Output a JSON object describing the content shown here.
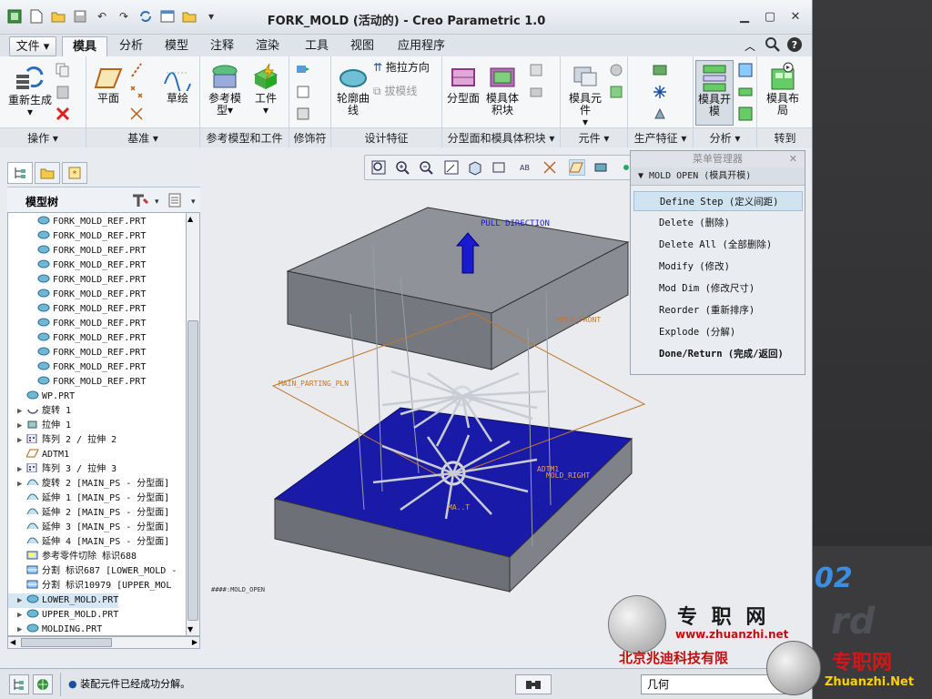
{
  "window": {
    "title": "FORK_MOLD (活动的) - Creo Parametric 1.0",
    "controls": [
      "minimize",
      "maximize",
      "close"
    ]
  },
  "tabs": [
    {
      "label": "文件 ▾",
      "active": false,
      "file": true
    },
    {
      "label": "模具",
      "active": true
    },
    {
      "label": "分析"
    },
    {
      "label": "模型"
    },
    {
      "label": "注释"
    },
    {
      "label": "渲染"
    },
    {
      "label": "工具"
    },
    {
      "label": "视图"
    },
    {
      "label": "应用程序"
    }
  ],
  "ribbon": {
    "groups": [
      {
        "label": "操作 ▾"
      },
      {
        "label": "基准 ▾"
      },
      {
        "label": "参考模型和工件"
      },
      {
        "label": "修饰符"
      },
      {
        "label": "设计特征"
      },
      {
        "label": "分型面和模具体积块 ▾"
      },
      {
        "label": "元件 ▾"
      },
      {
        "label": "生产特征 ▾"
      },
      {
        "label": "分析 ▾"
      },
      {
        "label": "转到"
      }
    ],
    "buttons": {
      "regenerate": "重新生成",
      "plane": "平面",
      "sketch": "草绘",
      "ref_model": "参考模型",
      "workpiece": "工件",
      "contour_curve": "轮廓曲线",
      "pull_direction": "拖拉方向",
      "draft_line": "拔模线",
      "parting_surface": "分型面",
      "mold_volume": "模具体积块",
      "mold_component": "模具元件",
      "mold_open": "模具开模",
      "mold_layout": "模具布局"
    }
  },
  "left_panel": {
    "title": "模型树",
    "rows": [
      {
        "text": "FORK_MOLD_REF.PRT",
        "indent": 2,
        "icon": "part",
        "exp": ""
      },
      {
        "text": "FORK_MOLD_REF.PRT",
        "indent": 2,
        "icon": "part",
        "exp": ""
      },
      {
        "text": "FORK_MOLD_REF.PRT",
        "indent": 2,
        "icon": "part",
        "exp": ""
      },
      {
        "text": "FORK_MOLD_REF.PRT",
        "indent": 2,
        "icon": "part",
        "exp": ""
      },
      {
        "text": "FORK_MOLD_REF.PRT",
        "indent": 2,
        "icon": "part",
        "exp": ""
      },
      {
        "text": "FORK_MOLD_REF.PRT",
        "indent": 2,
        "icon": "part",
        "exp": ""
      },
      {
        "text": "FORK_MOLD_REF.PRT",
        "indent": 2,
        "icon": "part",
        "exp": ""
      },
      {
        "text": "FORK_MOLD_REF.PRT",
        "indent": 2,
        "icon": "part",
        "exp": ""
      },
      {
        "text": "FORK_MOLD_REF.PRT",
        "indent": 2,
        "icon": "part",
        "exp": ""
      },
      {
        "text": "FORK_MOLD_REF.PRT",
        "indent": 2,
        "icon": "part",
        "exp": ""
      },
      {
        "text": "FORK_MOLD_REF.PRT",
        "indent": 2,
        "icon": "part",
        "exp": ""
      },
      {
        "text": "FORK_MOLD_REF.PRT",
        "indent": 2,
        "icon": "part",
        "exp": ""
      },
      {
        "text": "WP.PRT",
        "indent": 1,
        "icon": "part",
        "exp": ""
      },
      {
        "text": "旋转 1",
        "indent": 1,
        "icon": "revolve",
        "exp": "▶"
      },
      {
        "text": "拉伸 1",
        "indent": 1,
        "icon": "extrude",
        "exp": "▶"
      },
      {
        "text": "阵列 2 / 拉伸 2",
        "indent": 1,
        "icon": "pattern",
        "exp": "▶"
      },
      {
        "text": "ADTM1",
        "indent": 1,
        "icon": "datum",
        "exp": ""
      },
      {
        "text": "阵列 3 / 拉伸 3",
        "indent": 1,
        "icon": "pattern",
        "exp": "▶"
      },
      {
        "text": "旋转 2 [MAIN_PS - 分型面]",
        "indent": 1,
        "icon": "surface",
        "exp": "▶"
      },
      {
        "text": "延伸 1 [MAIN_PS - 分型面]",
        "indent": 1,
        "icon": "surface",
        "exp": ""
      },
      {
        "text": "延伸 2 [MAIN_PS - 分型面]",
        "indent": 1,
        "icon": "surface",
        "exp": ""
      },
      {
        "text": "延伸 3 [MAIN_PS - 分型面]",
        "indent": 1,
        "icon": "surface",
        "exp": ""
      },
      {
        "text": "延伸 4 [MAIN_PS - 分型面]",
        "indent": 1,
        "icon": "surface",
        "exp": ""
      },
      {
        "text": "参考零件切除 标识688",
        "indent": 1,
        "icon": "cut",
        "exp": ""
      },
      {
        "text": "分割 标识687 [LOWER_MOLD -",
        "indent": 1,
        "icon": "split",
        "exp": ""
      },
      {
        "text": "分割 标识10979 [UPPER_MOL",
        "indent": 1,
        "icon": "split",
        "exp": ""
      },
      {
        "text": "LOWER_MOLD.PRT",
        "indent": 1,
        "icon": "part",
        "exp": "▶",
        "highlight": true
      },
      {
        "text": "UPPER_MOLD.PRT",
        "indent": 1,
        "icon": "part",
        "exp": "▶"
      },
      {
        "text": "MOLDING.PRT",
        "indent": 1,
        "icon": "part",
        "exp": "▶"
      }
    ]
  },
  "graphics": {
    "labels": {
      "pull_direction": "PULL DIRECTION",
      "mold_front": "MOLD_FRONT",
      "main_parting": "MAIN_PARTING_PLN",
      "adtm1": "ADTM1",
      "mold_right": "MOLD_RIGHT",
      "ma": "MA..T",
      "status": "####:MOLD_OPEN"
    }
  },
  "menu_manager": {
    "title": "菜单管理器",
    "submenu": "MOLD OPEN (模具开模)",
    "items": [
      {
        "label": "Define Step (定义间距)",
        "selected": true
      },
      {
        "label": "Delete (删除)"
      },
      {
        "label": "Delete All (全部删除)"
      },
      {
        "label": "Modify (修改)"
      },
      {
        "label": "Mod Dim (修改尺寸)"
      },
      {
        "label": "Reorder (重新排序)"
      },
      {
        "label": "Explode (分解)"
      },
      {
        "label": "Done/Return (完成/返回)",
        "bold": true
      }
    ]
  },
  "status_bar": {
    "message": "装配元件已经成功分解。",
    "filter": "几何"
  },
  "watermark": {
    "brand": "专 职 网",
    "url": "www.zhuanzhi.net",
    "company": "北京兆迪科技有限",
    "brand2": "专职网",
    "url2": "Zhuanzhi.Net",
    "digits": "02",
    "dim_text": "rd"
  },
  "colors": {
    "lower_mold": "#1a1aa8",
    "upper_mold": "#7d8085",
    "accent": "#1f4ea3"
  }
}
